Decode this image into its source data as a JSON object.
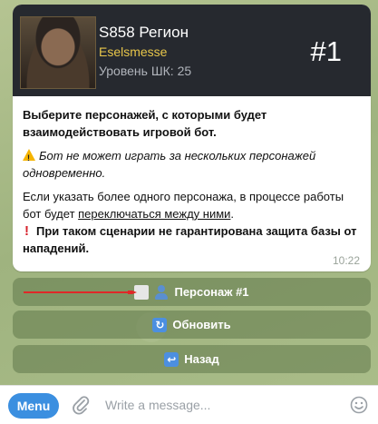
{
  "banner": {
    "title": "S858 Регион",
    "character_name": "Eselsmesse",
    "level": "Уровень ШК: 25",
    "badge": "#1"
  },
  "message": {
    "paragraph1": "Выберите персонажей, с которыми будет взаимодействовать игровой бот.",
    "warning_text": "Бот не может играть за нескольких персонажей одновременно.",
    "paragraph3_start": "Если указать более одного персонажа, в процессе работы бот будет ",
    "paragraph3_link": "переключаться между ними",
    "paragraph3_end": ".",
    "paragraph4": "При таком сценарии не гарантирована защита базы от нападений.",
    "time": "10:22"
  },
  "keyboard": {
    "character_button": "Персонаж #1",
    "refresh_button": "Обновить",
    "back_button": "Назад"
  },
  "input_bar": {
    "menu_label": "Menu",
    "placeholder": "Write a message..."
  },
  "colors": {
    "banner_bg": "#26292f",
    "name_color": "#e8c64a",
    "menu_button": "#3b8fe0",
    "annotation_arrow": "#e02828"
  },
  "icons": [
    "warning-icon",
    "exclamation-icon",
    "checkbox-icon",
    "person-icon",
    "refresh-icon",
    "back-icon",
    "attach-icon",
    "emoji-icon"
  ]
}
